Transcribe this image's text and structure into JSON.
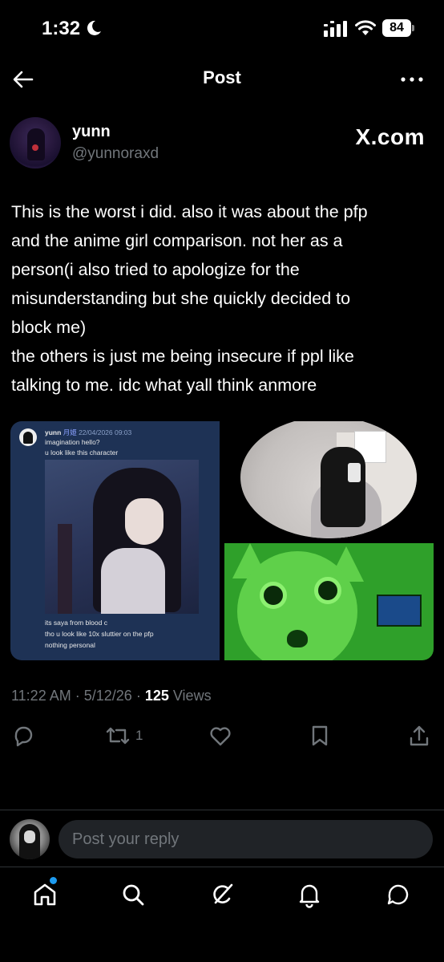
{
  "status_bar": {
    "time": "1:32",
    "battery": "84"
  },
  "header": {
    "title": "Post"
  },
  "author": {
    "name": "yunn",
    "handle": "@yunnoraxd",
    "source": "X.com"
  },
  "post": {
    "text_lines": [
      "This is the worst i did. also it was about the pfp",
      "and the anime girl comparison. not her as a",
      "person(i also tried to apologize for the",
      "misunderstanding but she quickly decided to",
      "block me)",
      "the others is just me being insecure if ppl like",
      "talking to me. idc what yall think anmore"
    ],
    "media": {
      "screenshot": {
        "name": "yunn",
        "badge": "月姫",
        "date": "22/04/2026 09:03",
        "line1": "imagination hello?",
        "line2": "u look like this character",
        "line3": "its saya from blood c",
        "line4": "tho u look like 10x sluttier on the pfp",
        "line5": "nothing personal"
      }
    },
    "time": "11:22 AM",
    "date": "5/12/26",
    "views_count": "125",
    "views_label": "Views",
    "retweet_count": "1"
  },
  "reply": {
    "placeholder": "Post your reply"
  },
  "tabs": [
    "home-icon",
    "search-icon",
    "grok-icon",
    "notifications-icon",
    "messages-icon"
  ],
  "colors": {
    "accent": "#1d9bf0",
    "muted": "#71767b",
    "background": "#000000"
  }
}
